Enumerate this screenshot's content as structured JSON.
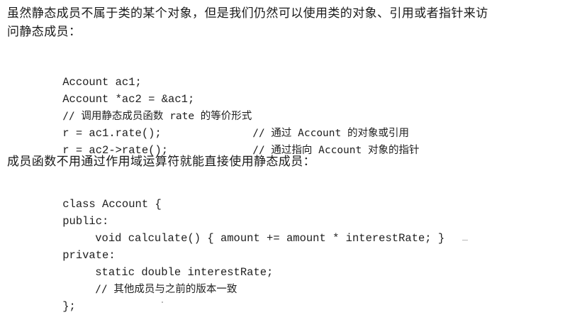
{
  "paragraphs": {
    "intro_line1": "虽然静态成员不属于类的某个对象，但是我们仍然可以使用类的对象、引用或者指针来访",
    "intro_line2": "问静态成员：",
    "member_access": "成员函数不用通过作用域运算符就能直接使用静态成员："
  },
  "code_block_1": {
    "line1": "Account ac1;",
    "line2": "Account *ac2 = &ac1;",
    "line3_comment": "// 调用静态成员函数 rate 的等价形式",
    "line4_code": "r = ac1.rate();",
    "line4_comment": "// 通过 Account 的对象或引用",
    "line5_code": "r = ac2->rate();",
    "line5_comment": "// 通过指向 Account 对象的指针"
  },
  "code_block_2": {
    "line1": "class Account {",
    "line2": "public:",
    "line3": "void calculate() { amount += amount * interestRate; }",
    "line4": "private:",
    "line5": "static double interestRate;",
    "line6": "// 其他成员与之前的版本一致",
    "line7": "};"
  }
}
